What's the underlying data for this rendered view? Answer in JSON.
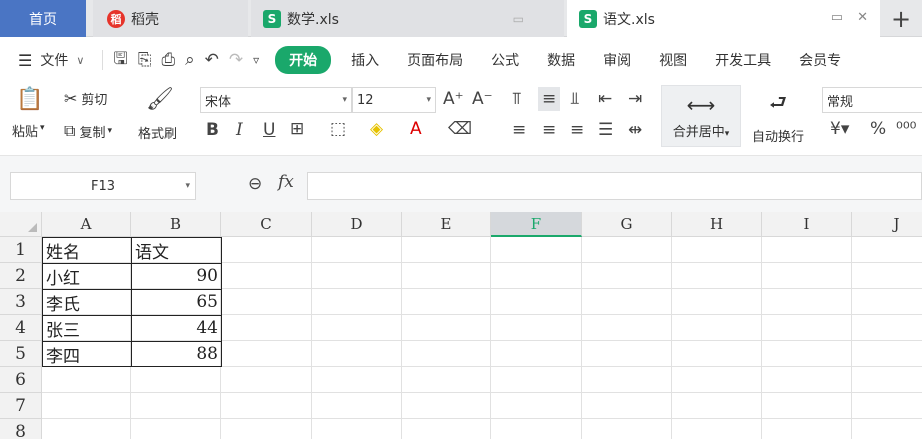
{
  "tabs": [
    {
      "label": "首页"
    },
    {
      "label": "稻壳",
      "logo": "稻"
    },
    {
      "label": "数学.xls",
      "logo": "S"
    },
    {
      "label": "语文.xls",
      "logo": "S"
    }
  ],
  "add_tab": "+",
  "menu": {
    "file": "文件",
    "items": [
      "开始",
      "插入",
      "页面布局",
      "公式",
      "数据",
      "审阅",
      "视图",
      "开发工具",
      "会员专"
    ]
  },
  "ribbon": {
    "paste": "粘贴",
    "cut": "剪切",
    "copy": "复制",
    "format_painter": "格式刷",
    "font_name": "宋体",
    "font_size": "12",
    "merge_center": "合并居中",
    "wrap_text": "自动换行",
    "number_format": "常规",
    "bold": "B",
    "italic": "I",
    "underline": "U"
  },
  "formula_bar": {
    "name_box": "F13",
    "fx": "fx",
    "value": ""
  },
  "columns": [
    "A",
    "B",
    "C",
    "D",
    "E",
    "F",
    "G",
    "H",
    "I",
    "J"
  ],
  "selected_column": "F",
  "rows": [
    "1",
    "2",
    "3",
    "4",
    "5",
    "6",
    "7",
    "8"
  ],
  "cells": [
    {
      "a": "姓名",
      "b": "语文"
    },
    {
      "a": "小红",
      "b": "90"
    },
    {
      "a": "李氏",
      "b": "65"
    },
    {
      "a": "张三",
      "b": "44"
    },
    {
      "a": "李四",
      "b": "88"
    }
  ],
  "colors": {
    "accent": "#1aa86b",
    "home_tab": "#4a75c4"
  }
}
